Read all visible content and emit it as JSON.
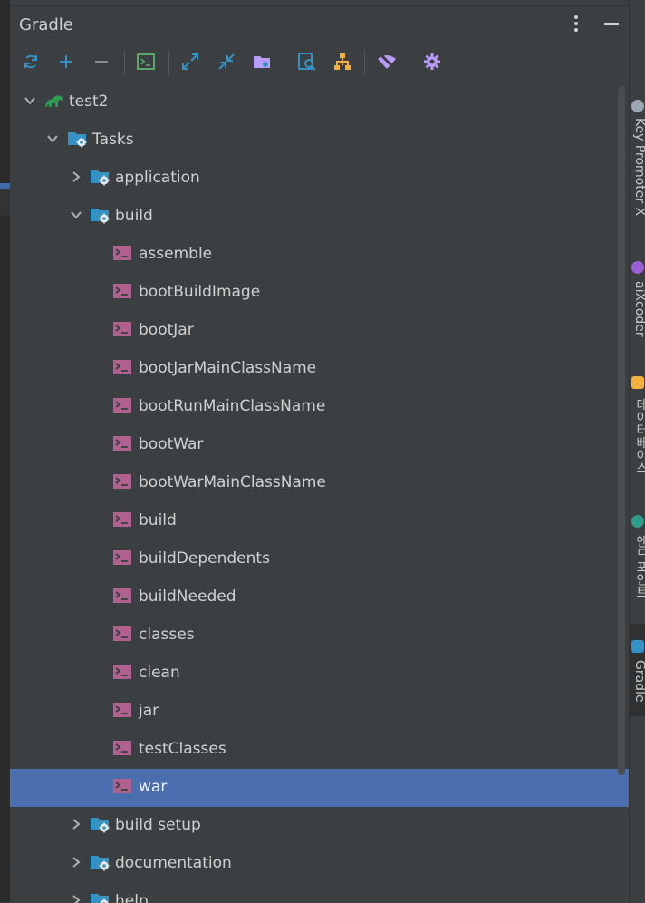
{
  "panel": {
    "title": "Gradle"
  },
  "toolbar": {
    "buttons": [
      {
        "name": "reload-all-gradle-projects",
        "icon": "refresh-icon"
      },
      {
        "name": "link-gradle-project",
        "icon": "plus-icon"
      },
      {
        "name": "unlink-gradle-project",
        "icon": "minus-icon"
      },
      {
        "name": "execute-gradle-task",
        "icon": "terminal-icon"
      },
      {
        "name": "expand-all",
        "icon": "expand-icon"
      },
      {
        "name": "collapse-all",
        "icon": "collapse-icon"
      },
      {
        "name": "open-gradle-config",
        "icon": "folder-icon"
      },
      {
        "name": "analyze-dependencies",
        "icon": "analyze-icon"
      },
      {
        "name": "show-dependencies",
        "icon": "hierarchy-icon"
      },
      {
        "name": "toggle-offline-mode",
        "icon": "offline-wifi-icon"
      },
      {
        "name": "gradle-settings",
        "icon": "gear-icon"
      }
    ]
  },
  "tree": {
    "project": "test2",
    "tasks_group": "Tasks",
    "groups": {
      "application": "application",
      "build": "build",
      "build_setup": "build setup",
      "documentation": "documentation",
      "help": "help"
    },
    "build_tasks": [
      "assemble",
      "bootBuildImage",
      "bootJar",
      "bootJarMainClassName",
      "bootRunMainClassName",
      "bootWar",
      "bootWarMainClassName",
      "build",
      "buildDependents",
      "buildNeeded",
      "classes",
      "clean",
      "jar",
      "testClasses",
      "war"
    ],
    "selected_task": "war"
  },
  "right_sidebar": {
    "tabs": [
      {
        "label": "Key Promoter X",
        "icon": "key-promoter-icon"
      },
      {
        "label": "aiXcoder",
        "icon": "aixcoder-icon"
      },
      {
        "label": "데이터베이스",
        "icon": "database-icon"
      },
      {
        "label": "엔드포인트",
        "icon": "endpoints-icon"
      },
      {
        "label": "Gradle",
        "icon": "gradle-icon"
      }
    ]
  },
  "colors": {
    "background": "#3c3f41",
    "selection": "#4b6eaf",
    "accent_blue": "#3592c4",
    "task_icon": "#b0618f",
    "gradle_green": "#2e9c4f"
  }
}
